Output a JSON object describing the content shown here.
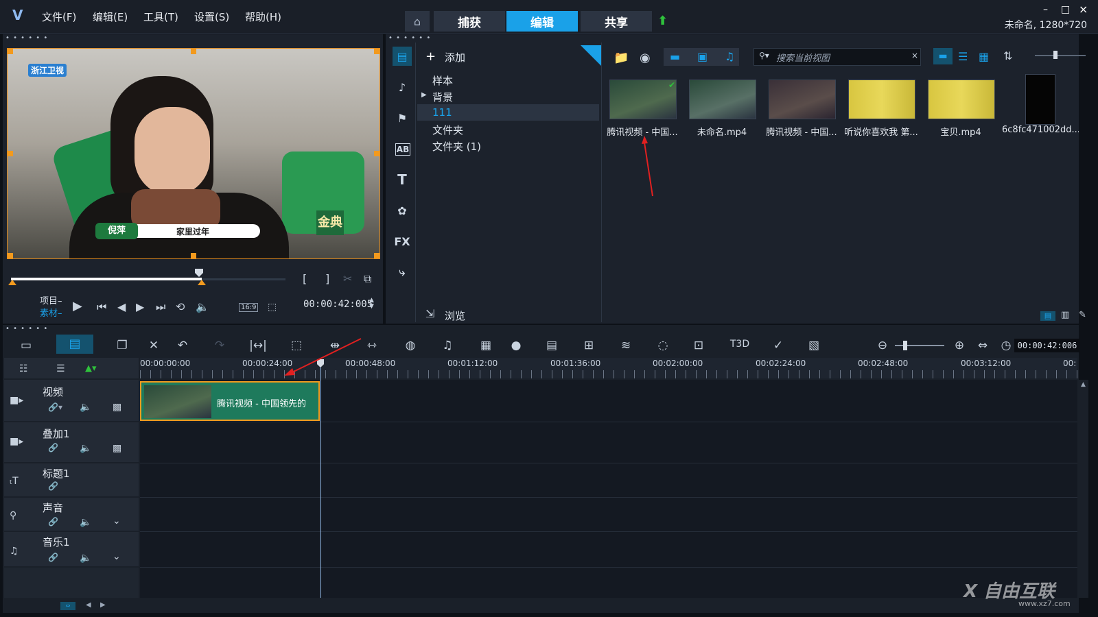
{
  "menu": [
    "文件(F)",
    "编辑(E)",
    "工具(T)",
    "设置(S)",
    "帮助(H)"
  ],
  "tabs": {
    "capture": "捕获",
    "edit": "编辑",
    "share": "共享"
  },
  "window": {
    "minimize": "–",
    "maximize": "□",
    "close": "×"
  },
  "project_info": "未命名, 1280*720",
  "preview": {
    "channel_logo": "浙江卫视",
    "caption_name": "倪萍",
    "caption_text": "家里过年",
    "brand": "金典",
    "mode_project": "项目",
    "mode_clip": "素材",
    "aspect": "16:9",
    "timecode": "00:00:42:005",
    "mark_in": "[",
    "mark_out": "]"
  },
  "library": {
    "add_label": "添加",
    "folders": [
      "样本",
      "背景",
      "111",
      "文件夹",
      "文件夹 (1)"
    ],
    "selected_folder": "111",
    "search_placeholder": "搜索当前视图",
    "browse_label": "浏览",
    "fx_label": "FX",
    "ab_label": "AB",
    "t_label": "T",
    "media": [
      {
        "name": "腾讯视频 - 中国...",
        "color": "#4f6a4e"
      },
      {
        "name": "未命名.mp4",
        "color": "#587066"
      },
      {
        "name": "腾讯视频 - 中国...",
        "color": "#5a4d4a"
      },
      {
        "name": "听说你喜欢我 第...",
        "color": "#d8c640"
      },
      {
        "name": "宝贝.mp4",
        "color": "#d8c640"
      },
      {
        "name": "6c8fc471002dd...",
        "color": "#050505"
      }
    ]
  },
  "timeline": {
    "timecode": "00:00:42:006",
    "ruler": [
      "00:00:00:00",
      "00:00:24:00",
      "00:00:48:00",
      "00:01:12:00",
      "00:01:36:00",
      "00:02:00:00",
      "00:02:24:00",
      "00:02:48:00",
      "00:03:12:00",
      "00:"
    ],
    "tracks": [
      "视频",
      "叠加1",
      "标题1",
      "声音",
      "音乐1"
    ],
    "clip_title": "腾讯视频 - 中国领先的",
    "t3d_label": "T3D"
  },
  "watermark": {
    "brand": "X 自由互联",
    "url": "www.xz7.com"
  },
  "colors": {
    "accent": "#1aa1e8",
    "clip": "#1e7a5c",
    "orange": "#f29a1e"
  }
}
